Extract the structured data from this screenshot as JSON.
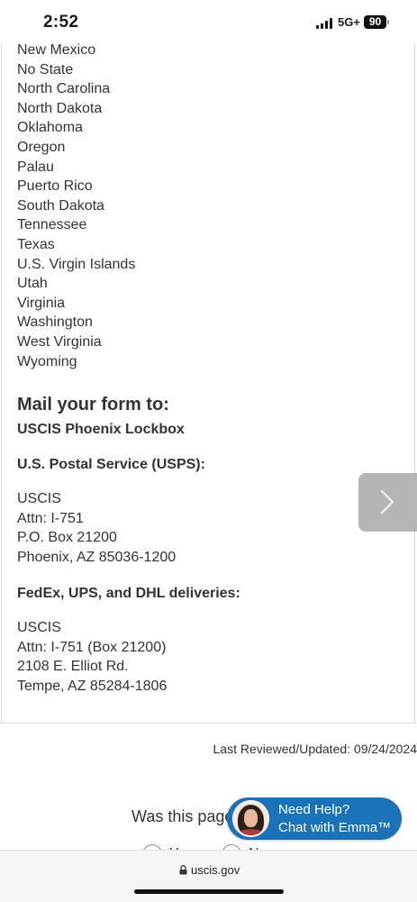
{
  "status_bar": {
    "time": "2:52",
    "network": "5G+",
    "battery": "90"
  },
  "states": [
    "New Mexico",
    "No State",
    "North Carolina",
    "North Dakota",
    "Oklahoma",
    "Oregon",
    "Palau",
    "Puerto Rico",
    "South Dakota",
    "Tennessee",
    "Texas",
    "U.S. Virgin Islands",
    "Utah",
    "Virginia",
    "Washington",
    "West Virginia",
    "Wyoming"
  ],
  "mail": {
    "heading": "Mail your form to:",
    "lockbox": "USCIS Phoenix Lockbox",
    "usps_heading": "U.S. Postal Service (USPS):",
    "usps_address": [
      "USCIS",
      "Attn: I-751",
      "P.O. Box 21200",
      "Phoenix, AZ 85036-1200"
    ],
    "courier_heading": "FedEx, UPS, and DHL deliveries:",
    "courier_address": [
      "USCIS",
      "Attn: I-751 (Box 21200)",
      "2108 E. Elliot Rd.",
      "Tempe, AZ 85284-1806"
    ]
  },
  "footer": {
    "last_reviewed": "Last Reviewed/Updated:  09/24/2024",
    "helpful_question": "Was this page",
    "radio_yes": "Y",
    "radio_no": "N"
  },
  "chat": {
    "line1": "Need Help?",
    "line2": "Chat with Emma™"
  },
  "browser": {
    "url": "uscis.gov"
  },
  "colors": {
    "chat_blue": "#1a72b8",
    "next_button_gray": "#a9a9a9"
  },
  "icons": {
    "next": "chevron-right-icon",
    "lock": "lock-icon",
    "signal": "signal-bars-icon"
  }
}
